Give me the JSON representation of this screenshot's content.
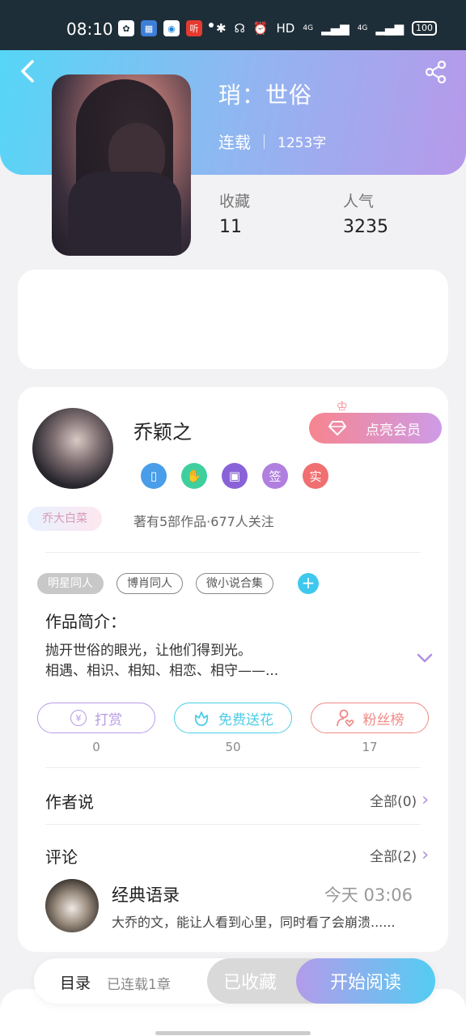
{
  "status_bar": {
    "time": "08:10",
    "app_icons": [
      "paw-icon",
      "calendar-icon",
      "record-icon",
      "listen-icon"
    ],
    "app_icon_listen_text": "听",
    "network_hd": "HD",
    "network_4g_1": "4G",
    "network_4g_2": "4G",
    "battery": "100"
  },
  "book": {
    "title": "琑：世俗",
    "status": "连载",
    "word_count": "1253字",
    "stats": [
      {
        "label": "收藏",
        "value": "11"
      },
      {
        "label": "人气",
        "value": "3235"
      }
    ]
  },
  "author": {
    "name": "乔颖之",
    "nickname_badge": "乔大白菜",
    "meta": "著有5部作品·677人关注",
    "vip_button": "点亮会员",
    "badges": [
      {
        "icon": "phone-badge-icon",
        "color": "#4a9de8"
      },
      {
        "icon": "handshake-badge-icon",
        "color": "#3fcf9f"
      },
      {
        "icon": "calendar-badge-icon",
        "color": "#8a62d8"
      },
      {
        "text": "签",
        "color": "#b07fe0"
      },
      {
        "text": "实",
        "color": "#f06f70"
      }
    ]
  },
  "tags": [
    "明星同人",
    "博肖同人",
    "微小说合集"
  ],
  "tag_add": "+",
  "intro": {
    "heading": "作品简介：",
    "line1": "抛开世俗的眼光，让他们得到光。",
    "line2": "相遇、相识、相知、相恋、相守——..."
  },
  "actions": [
    {
      "label": "打赏",
      "count": "0",
      "color": "#b79be6"
    },
    {
      "label": "免费送花",
      "count": "50",
      "color": "#4dcde6"
    },
    {
      "label": "粉丝榜",
      "count": "17",
      "color": "#f08a86"
    }
  ],
  "author_says": {
    "title": "作者说",
    "more": "全部(0)"
  },
  "comments": {
    "title": "评论",
    "more": "全部(2)",
    "item": {
      "user": "经典语录",
      "time": "今天 03:06",
      "text": "大乔的文，能让人看到心里，同时看了会崩溃......"
    }
  },
  "bottom_bar": {
    "toc": "目录",
    "toc_status": "已连载1章",
    "collected": "已收藏",
    "read": "开始阅读"
  }
}
